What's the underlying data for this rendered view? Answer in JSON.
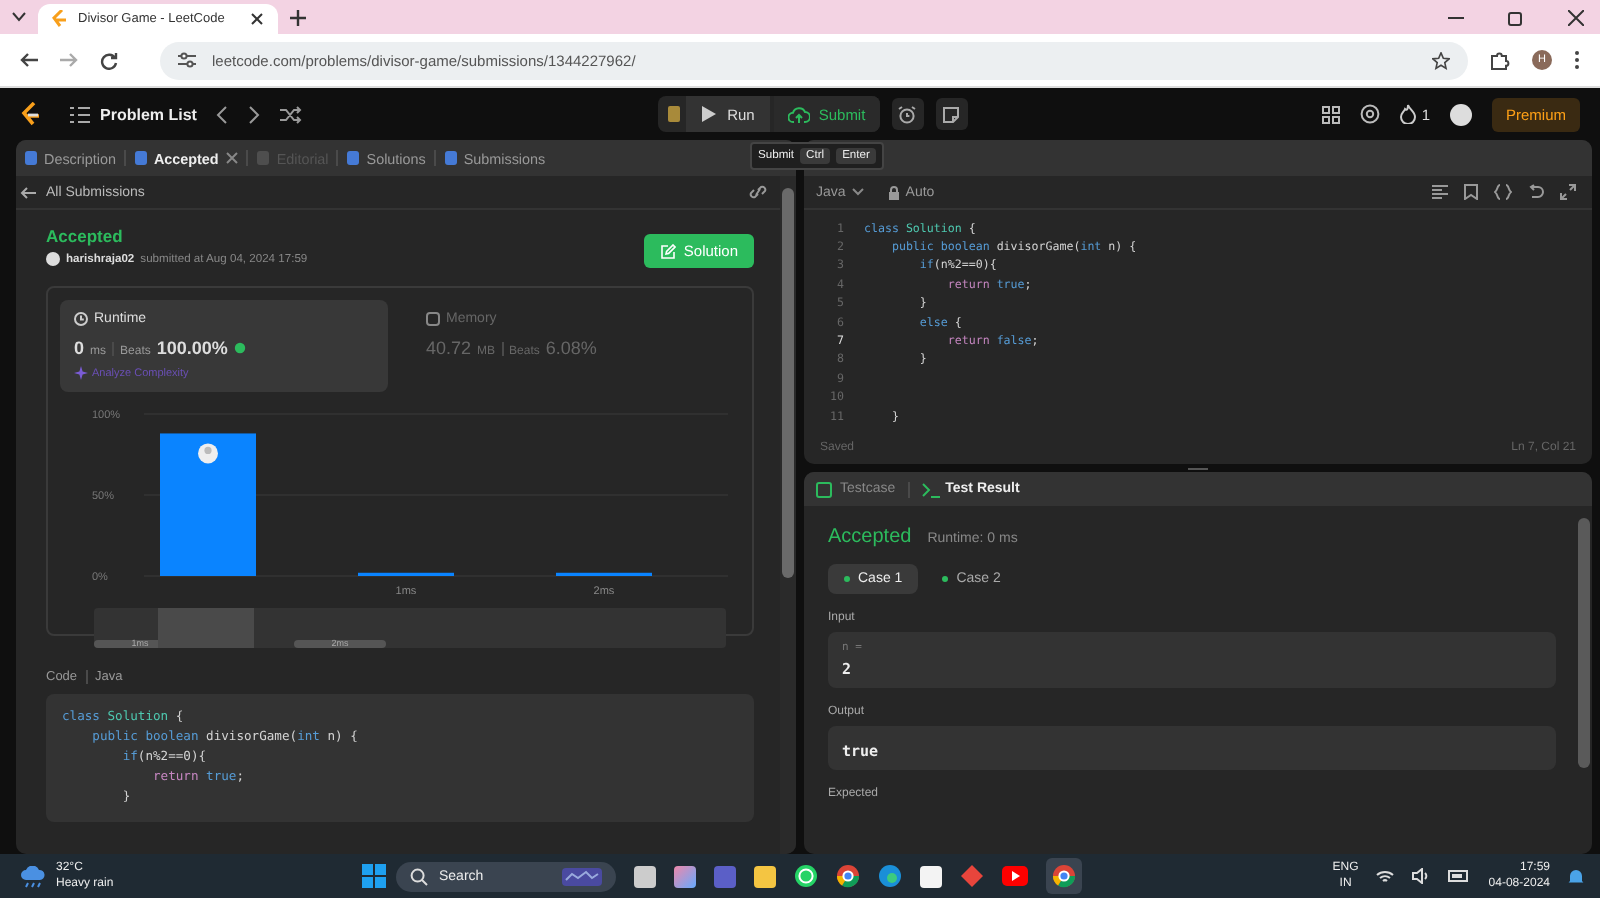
{
  "browser": {
    "tab_title": "Divisor Game - LeetCode",
    "url": "leetcode.com/problems/divisor-game/submissions/1344227962/",
    "profile_letter": "H"
  },
  "topbar": {
    "problem_list": "Problem List",
    "run": "Run",
    "submit": "Submit",
    "streak": "1",
    "premium": "Premium"
  },
  "tooltip": {
    "label": "Submit",
    "keys": [
      "Ctrl",
      "Enter"
    ]
  },
  "left_tabs": [
    {
      "label": "Description",
      "selected": false,
      "disabled": false,
      "closable": false
    },
    {
      "label": "Accepted",
      "selected": true,
      "disabled": false,
      "closable": true
    },
    {
      "label": "Editorial",
      "selected": false,
      "disabled": true,
      "closable": false
    },
    {
      "label": "Solutions",
      "selected": false,
      "disabled": false,
      "closable": false
    },
    {
      "label": "Submissions",
      "selected": false,
      "disabled": false,
      "closable": false
    }
  ],
  "back_link": "All Submissions",
  "submission": {
    "status": "Accepted",
    "user": "harishraja02",
    "submitted": "submitted at Aug 04, 2024 17:59",
    "solution_button": "Solution"
  },
  "stats": [
    {
      "title": "Runtime",
      "value": "0",
      "unit": "ms",
      "beats_label": "Beats",
      "beats": "100.00%",
      "selected": true,
      "link": "Analyze Complexity"
    },
    {
      "title": "Memory",
      "value": "40.72",
      "unit": "MB",
      "beats_label": "Beats",
      "beats": "6.08%",
      "selected": false
    }
  ],
  "chart_data": {
    "type": "bar",
    "categories": [
      null,
      "1ms",
      "2ms"
    ],
    "values": [
      88,
      2,
      2
    ],
    "ylim": [
      0,
      100
    ],
    "yticks": [
      {
        "value": 0,
        "label": "0%"
      },
      {
        "value": 50,
        "label": "50%"
      },
      {
        "value": 100,
        "label": "100%"
      }
    ]
  },
  "overview_labels": [
    "1ms",
    "2ms"
  ],
  "code_section": {
    "label": "Code",
    "language": "Java",
    "lines": [
      [
        {
          "kind": "kw",
          "text": "class"
        },
        {
          "kind": "ty",
          "text": " Solution"
        },
        {
          "kind": "p",
          "text": " {"
        }
      ],
      [
        {
          "kind": "kw",
          "text": "    public"
        },
        {
          "kind": "kw",
          "text": " boolean"
        },
        {
          "kind": "p",
          "text": " divisorGame("
        },
        {
          "kind": "kw",
          "text": "int"
        },
        {
          "kind": "p",
          "text": " n) {"
        }
      ],
      [
        {
          "kind": "kw",
          "text": "        if"
        },
        {
          "kind": "p",
          "text": "(n%2==0){"
        }
      ],
      [
        {
          "kind": "rt",
          "text": "            return"
        },
        {
          "kind": "kw",
          "text": " true"
        },
        {
          "kind": "p",
          "text": ";"
        }
      ],
      [
        {
          "kind": "p",
          "text": "        }"
        }
      ]
    ]
  },
  "editor": {
    "language": "Java",
    "mode": "Auto",
    "status": "Saved",
    "cursor": "Ln 7, Col 21",
    "lines": [
      {
        "n": "1",
        "current": false,
        "tokens": [
          {
            "kind": "kw",
            "text": "class"
          },
          {
            "kind": "ty",
            "text": " Solution"
          },
          {
            "kind": "p",
            "text": " {"
          }
        ]
      },
      {
        "n": "2",
        "current": false,
        "tokens": [
          {
            "kind": "kw",
            "text": "    public"
          },
          {
            "kind": "kw",
            "text": " boolean"
          },
          {
            "kind": "p",
            "text": " divisorGame("
          },
          {
            "kind": "kw",
            "text": "int"
          },
          {
            "kind": "p",
            "text": " n) {"
          }
        ]
      },
      {
        "n": "3",
        "current": false,
        "tokens": [
          {
            "kind": "kw",
            "text": "        if"
          },
          {
            "kind": "p",
            "text": "(n%2==0){"
          }
        ]
      },
      {
        "n": "4",
        "current": false,
        "tokens": [
          {
            "kind": "rt",
            "text": "            return"
          },
          {
            "kind": "kw",
            "text": " true"
          },
          {
            "kind": "p",
            "text": ";"
          }
        ]
      },
      {
        "n": "5",
        "current": false,
        "tokens": [
          {
            "kind": "p",
            "text": "        }"
          }
        ]
      },
      {
        "n": "6",
        "current": false,
        "tokens": [
          {
            "kind": "kw",
            "text": "        else"
          },
          {
            "kind": "p",
            "text": " {"
          }
        ]
      },
      {
        "n": "7",
        "current": true,
        "tokens": [
          {
            "kind": "rt",
            "text": "            return"
          },
          {
            "kind": "kw",
            "text": " false"
          },
          {
            "kind": "p",
            "text": ";"
          }
        ]
      },
      {
        "n": "8",
        "current": false,
        "tokens": [
          {
            "kind": "p",
            "text": "        }"
          }
        ]
      },
      {
        "n": "9",
        "current": false
      },
      {
        "n": "10",
        "current": false
      },
      {
        "n": "11",
        "current": false,
        "tokens": [
          {
            "kind": "p",
            "text": "    }"
          }
        ]
      }
    ]
  },
  "result_tabs": [
    {
      "label": "Testcase",
      "selected": false
    },
    {
      "label": "Test Result",
      "selected": true
    }
  ],
  "result": {
    "status": "Accepted",
    "runtime": "Runtime: 0 ms",
    "cases": [
      {
        "label": "Case 1",
        "selected": true
      },
      {
        "label": "Case 2",
        "selected": false
      }
    ],
    "input_label": "Input",
    "input_name": "n =",
    "input_value": "2",
    "output_label": "Output",
    "output_value": "true",
    "expected_label": "Expected"
  },
  "taskbar": {
    "temperature": "32°C",
    "weather": "Heavy rain",
    "search": "Search",
    "lang": "ENG",
    "region": "IN",
    "time": "17:59",
    "date": "04-08-2024"
  }
}
